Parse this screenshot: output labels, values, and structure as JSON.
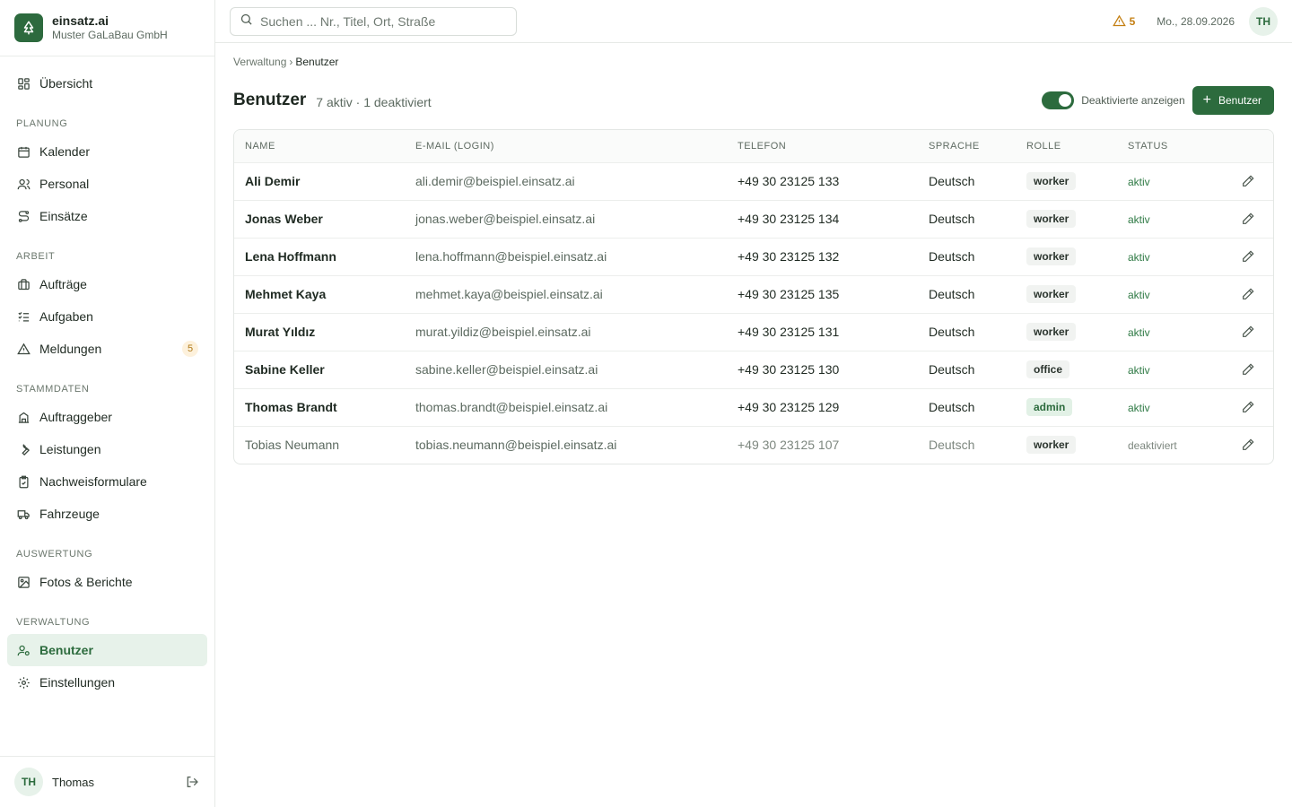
{
  "brand": {
    "name": "einsatz.ai",
    "org": "Muster GaLaBau GmbH"
  },
  "nav": {
    "overview": "Übersicht",
    "sections": {
      "planung": "PLANUNG",
      "arbeit": "ARBEIT",
      "stammdaten": "STAMMDATEN",
      "auswertung": "AUSWERTUNG",
      "verwaltung": "VERWALTUNG"
    },
    "items": {
      "kalender": "Kalender",
      "personal": "Personal",
      "einsaetze": "Einsätze",
      "auftraege": "Aufträge",
      "aufgaben": "Aufgaben",
      "meldungen": "Meldungen",
      "meldungen_badge": "5",
      "auftraggeber": "Auftraggeber",
      "leistungen": "Leistungen",
      "nachweisformulare": "Nachweisformulare",
      "fahrzeuge": "Fahrzeuge",
      "fotos": "Fotos & Berichte",
      "benutzer": "Benutzer",
      "einstellungen": "Einstellungen"
    }
  },
  "user": {
    "initials": "TH",
    "name": "Thomas"
  },
  "topbar": {
    "search_placeholder": "Suchen ... Nr., Titel, Ort, Straße",
    "alert_count": "5",
    "date": "Mo., 28.09.2026",
    "avatar": "TH"
  },
  "breadcrumb": {
    "parent": "Verwaltung",
    "sep": "›",
    "current": "Benutzer"
  },
  "page": {
    "title": "Benutzer",
    "subtitle": "7 aktiv · 1 deaktiviert",
    "toggle_label": "Deaktivierte anzeigen",
    "add_button": "Benutzer"
  },
  "table": {
    "columns": [
      "NAME",
      "E-MAIL (LOGIN)",
      "TELEFON",
      "SPRACHE",
      "ROLLE",
      "STATUS"
    ],
    "rows": [
      {
        "name": "Ali Demir",
        "email": "ali.demir@beispiel.einsatz.ai",
        "phone": "+49 30 23125 133",
        "lang": "Deutsch",
        "role": "worker",
        "status": "aktiv"
      },
      {
        "name": "Jonas Weber",
        "email": "jonas.weber@beispiel.einsatz.ai",
        "phone": "+49 30 23125 134",
        "lang": "Deutsch",
        "role": "worker",
        "status": "aktiv"
      },
      {
        "name": "Lena Hoffmann",
        "email": "lena.hoffmann@beispiel.einsatz.ai",
        "phone": "+49 30 23125 132",
        "lang": "Deutsch",
        "role": "worker",
        "status": "aktiv"
      },
      {
        "name": "Mehmet Kaya",
        "email": "mehmet.kaya@beispiel.einsatz.ai",
        "phone": "+49 30 23125 135",
        "lang": "Deutsch",
        "role": "worker",
        "status": "aktiv"
      },
      {
        "name": "Murat Yıldız",
        "email": "murat.yildiz@beispiel.einsatz.ai",
        "phone": "+49 30 23125 131",
        "lang": "Deutsch",
        "role": "worker",
        "status": "aktiv"
      },
      {
        "name": "Sabine Keller",
        "email": "sabine.keller@beispiel.einsatz.ai",
        "phone": "+49 30 23125 130",
        "lang": "Deutsch",
        "role": "office",
        "status": "aktiv"
      },
      {
        "name": "Thomas Brandt",
        "email": "thomas.brandt@beispiel.einsatz.ai",
        "phone": "+49 30 23125 129",
        "lang": "Deutsch",
        "role": "admin",
        "status": "aktiv"
      },
      {
        "name": "Tobias Neumann",
        "email": "tobias.neumann@beispiel.einsatz.ai",
        "phone": "+49 30 23125 107",
        "lang": "Deutsch",
        "role": "worker",
        "status": "deaktiviert"
      }
    ]
  },
  "colors": {
    "primary": "#2c6b3d",
    "active_bg": "#e7f2ea",
    "warning": "#c47f12"
  }
}
